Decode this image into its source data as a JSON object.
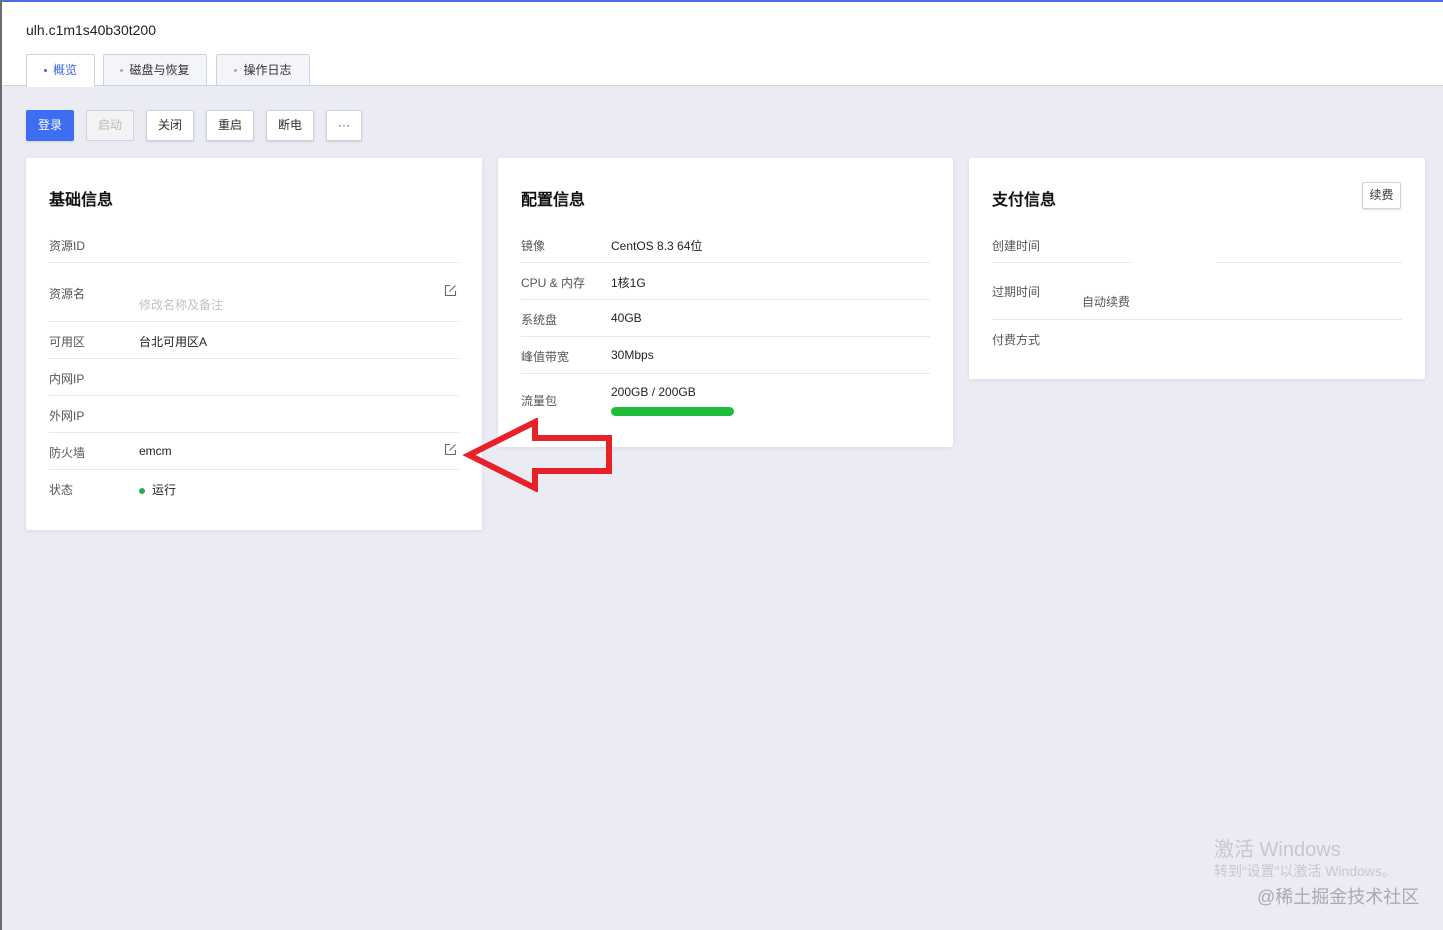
{
  "header": {
    "instance_id": "ulh.c1m1s40b30t200",
    "tabs": [
      {
        "label": "概览",
        "active": true
      },
      {
        "label": "磁盘与恢复",
        "active": false
      },
      {
        "label": "操作日志",
        "active": false
      }
    ]
  },
  "actions": {
    "login": "登录",
    "start": "启动",
    "stop": "关闭",
    "restart": "重启",
    "power_off": "断电",
    "more": "···"
  },
  "basic_info": {
    "title": "基础信息",
    "resource_id_label": "资源ID",
    "resource_id_value": "",
    "resource_name_label": "资源名",
    "resource_name_hint": "修改名称及备注",
    "zone_label": "可用区",
    "zone_value": "台北可用区A",
    "private_ip_label": "内网IP",
    "public_ip_label": "外网IP",
    "firewall_label": "防火墙",
    "firewall_value": "emcm",
    "status_label": "状态",
    "status_value": "运行"
  },
  "config_info": {
    "title": "配置信息",
    "image_label": "镜像",
    "image_value": "CentOS 8.3 64位",
    "cpu_mem_label": "CPU & 内存",
    "cpu_mem_value": "1核1G",
    "system_disk_label": "系统盘",
    "system_disk_value": "40GB",
    "bandwidth_label": "峰值带宽",
    "bandwidth_value": "30Mbps",
    "traffic_label": "流量包",
    "traffic_value": "200GB / 200GB",
    "traffic_remaining_fraction": 1.0
  },
  "payment_info": {
    "title": "支付信息",
    "renew_button": "续费",
    "created_label": "创建时间",
    "expire_label": "过期时间",
    "auto_renew": "自动续费",
    "payment_method_label": "付费方式"
  },
  "watermark": {
    "activate_title": "激活 Windows",
    "activate_sub": "转到“设置”以激活 Windows。",
    "credit": "@稀土掘金技术社区"
  },
  "colors": {
    "primary": "#3d6df0",
    "tab_active": "#3d63dd",
    "status_running": "#25b049",
    "progress": "#1fbb3a",
    "arrow": "#e8202a"
  }
}
